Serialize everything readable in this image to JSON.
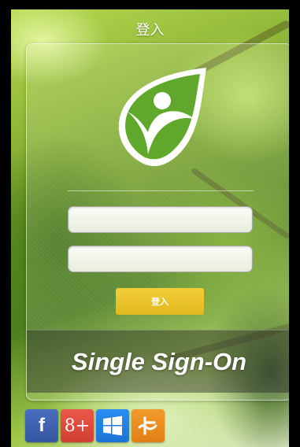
{
  "header": {
    "title": "登入"
  },
  "login_form": {
    "username": {
      "value": "",
      "placeholder": ""
    },
    "password": {
      "value": "",
      "placeholder": ""
    },
    "submit_label": "登入"
  },
  "banner": {
    "text": "Single Sign-On"
  },
  "social_logins": [
    {
      "name": "facebook",
      "glyph": "f",
      "color": "#3b5998"
    },
    {
      "name": "google-plus",
      "glyph": "8+",
      "color": "#dd4b39"
    },
    {
      "name": "windows",
      "glyph": "windows-logo",
      "color": "#1e88e5"
    },
    {
      "name": "other",
      "glyph": "orange-logo",
      "color": "#f28c1f"
    }
  ],
  "colors": {
    "logo_green": "#5fa82b",
    "button_yellow": "#ebc52a"
  }
}
